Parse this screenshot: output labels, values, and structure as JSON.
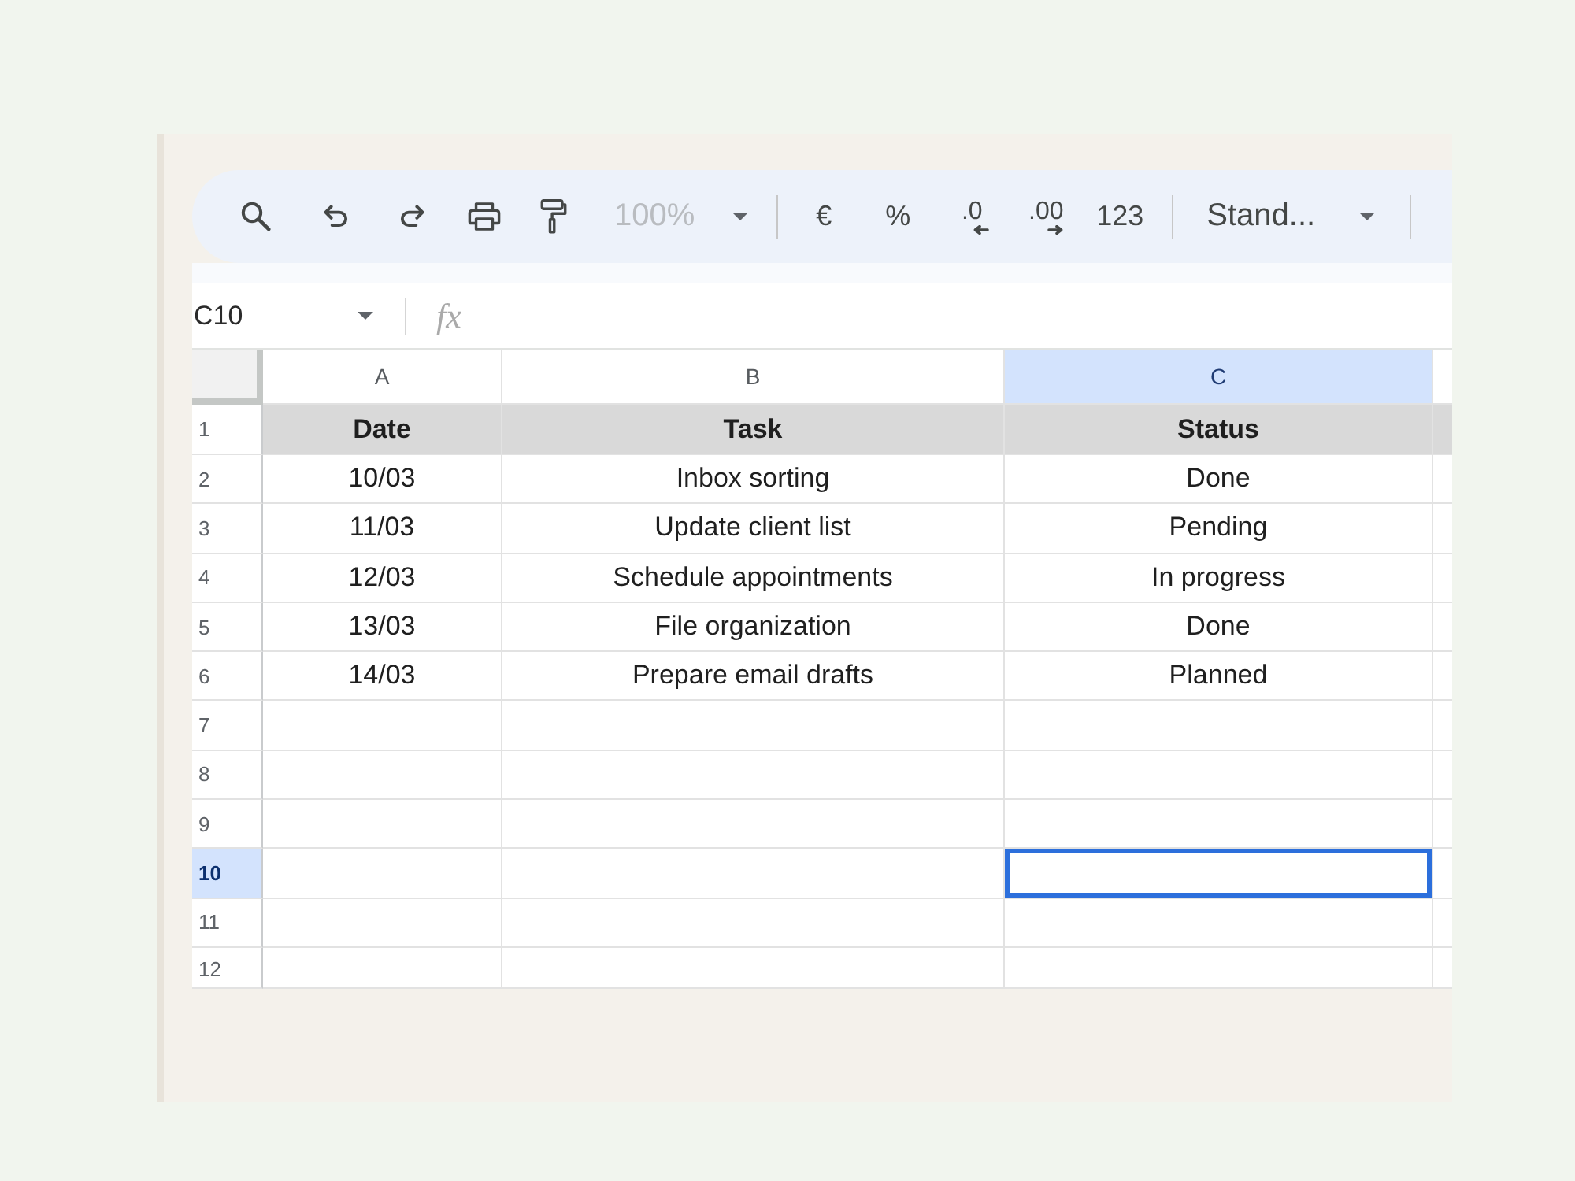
{
  "toolbar": {
    "zoom": {
      "value": "100%",
      "disabled": true
    },
    "format_buttons": [
      {
        "kind": "plain",
        "label": "€"
      },
      {
        "kind": "plain",
        "label": "%"
      },
      {
        "kind": "decrease",
        "label": ".0"
      },
      {
        "kind": "increase",
        "label": ".00"
      },
      {
        "kind": "plain",
        "label": "123"
      }
    ],
    "font": {
      "value": "Stand..."
    }
  },
  "formula_bar": {
    "name_box": "C10",
    "label": "fx"
  },
  "grid": {
    "columns": [
      {
        "label": "A",
        "selected": false
      },
      {
        "label": "B",
        "selected": false
      },
      {
        "label": "C",
        "selected": true
      }
    ],
    "rows": [
      {
        "number": "1",
        "kind": "header",
        "selected": false,
        "cells": [
          "Date",
          "Task",
          "Status"
        ]
      },
      {
        "number": "2",
        "kind": "data",
        "selected": false,
        "cells": [
          "10/03",
          "Inbox sorting",
          "Done"
        ]
      },
      {
        "number": "3",
        "kind": "data",
        "selected": false,
        "cells": [
          "11/03",
          "Update client list",
          "Pending"
        ]
      },
      {
        "number": "4",
        "kind": "data",
        "selected": false,
        "cells": [
          "12/03",
          "Schedule appointments",
          "In progress"
        ]
      },
      {
        "number": "5",
        "kind": "data",
        "selected": false,
        "cells": [
          "13/03",
          "File organization",
          "Done"
        ]
      },
      {
        "number": "6",
        "kind": "data",
        "selected": false,
        "cells": [
          "14/03",
          "Prepare email drafts",
          "Planned"
        ]
      },
      {
        "number": "7",
        "kind": "data",
        "selected": false
      },
      {
        "number": "8",
        "kind": "data",
        "selected": false
      },
      {
        "number": "9",
        "kind": "data",
        "selected": false
      },
      {
        "number": "10",
        "kind": "data",
        "selected": true
      },
      {
        "number": "11",
        "kind": "data",
        "selected": false
      },
      {
        "number": "12",
        "kind": "data",
        "selected": false
      }
    ]
  }
}
